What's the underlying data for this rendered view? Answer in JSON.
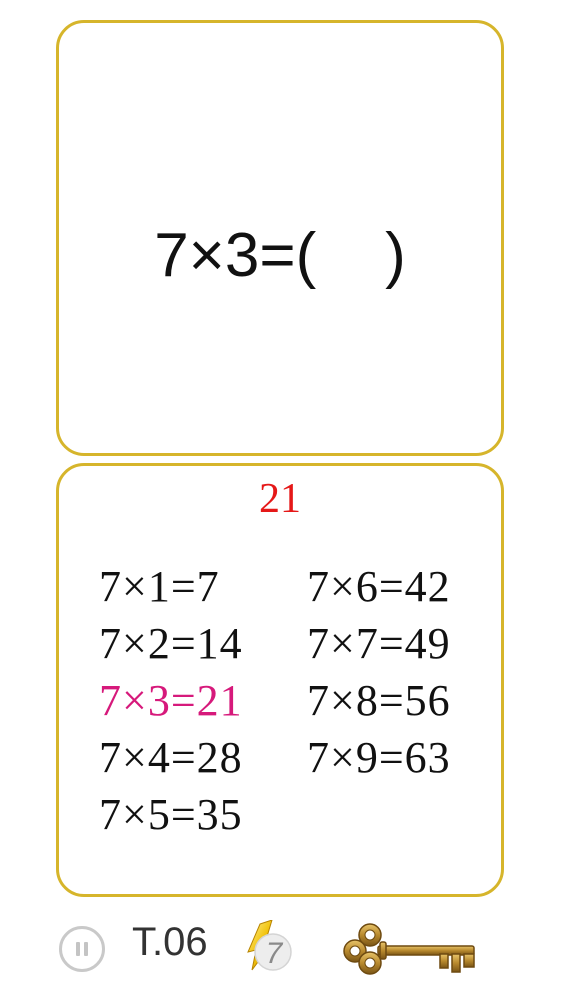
{
  "question": {
    "text": "7×3=(    )"
  },
  "answer": {
    "value": "21",
    "value_color": "#e51818",
    "table_left": [
      {
        "text": "7×1=7",
        "highlighted": false
      },
      {
        "text": "7×2=14",
        "highlighted": false
      },
      {
        "text": "7×3=21",
        "highlighted": true
      },
      {
        "text": "7×4=28",
        "highlighted": false
      },
      {
        "text": "7×5=35",
        "highlighted": false
      }
    ],
    "table_right": [
      {
        "text": "7×6=42",
        "highlighted": false
      },
      {
        "text": "7×7=49",
        "highlighted": false
      },
      {
        "text": "7×8=56",
        "highlighted": false
      },
      {
        "text": "7×9=63",
        "highlighted": false
      }
    ],
    "highlight_color": "#d6197b"
  },
  "bottom_bar": {
    "pause_icon": "pause-icon",
    "stage_label": "T.06",
    "hint_count": "7",
    "hint_icon": "hint-coin-icon",
    "key_icon": "key-icon"
  },
  "colors": {
    "card_border": "#d6b52b",
    "text": "#111111",
    "gold": "#b88a2c"
  }
}
